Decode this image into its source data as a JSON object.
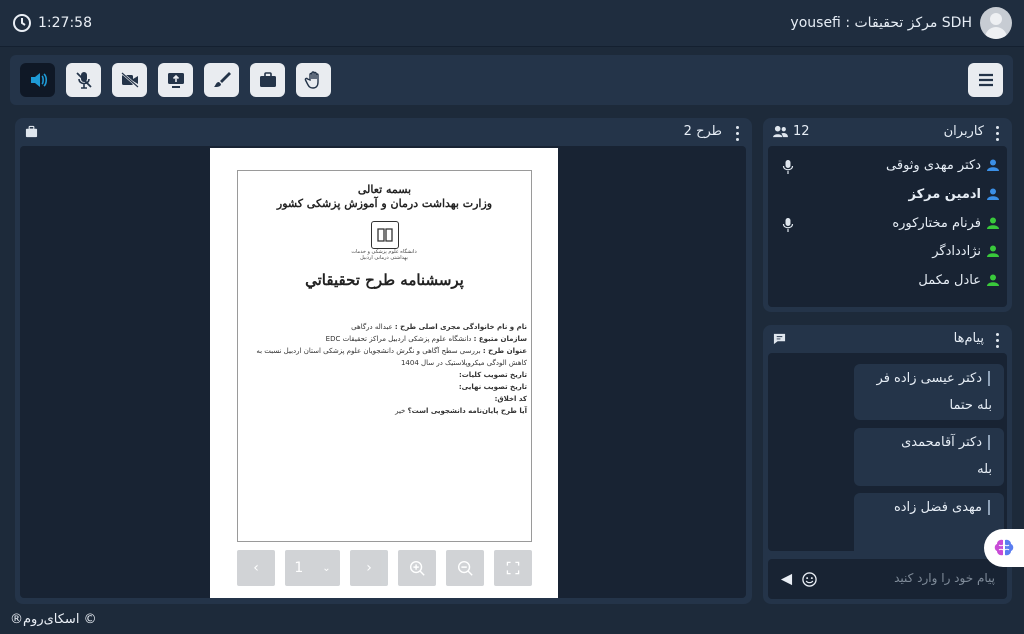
{
  "header": {
    "clock": "1:27:58",
    "user_label": "yousefi : مرکز تحقیقات SDH"
  },
  "toolbar": {
    "buttons": [
      "speaker",
      "microphone-muted",
      "camera-off",
      "share-screen",
      "brush",
      "briefcase",
      "raise-hand"
    ],
    "active_color": "#0f1826",
    "accent": "#1e9ad6"
  },
  "presentation": {
    "title": "طرح 2",
    "doc": {
      "line1": "بسمه تعالی",
      "line2": "وزارت بهداشت درمان و آموزش پزشکی کشور",
      "logo_text": "دانشگاه علوم پزشکی و خدمات بهداشتی درمانی اردبیل",
      "main_title": "پرسشنامه طرح تحقیقاتي",
      "fields": [
        {
          "label": "نام و نام خانوادگی مجری اصلی طرح :",
          "value": "عبداله درگاهی"
        },
        {
          "label": "سازمان متبوع :",
          "value": "دانشگاه علوم پزشکی اردبیل مراکز تحقیقات EDC"
        },
        {
          "label": "عنوان طرح :",
          "value": "بررسی سطح آگاهی و نگرش دانشجویان علوم پزشکی استان اردبیل نسبت به کاهش الودگی میکروپلاستیک در سال 1404"
        },
        {
          "label": "تاریخ تصویب کلیات:",
          "value": ""
        },
        {
          "label": "تاریخ تصویب نهایی:",
          "value": ""
        },
        {
          "label": "کد اخلاق:",
          "value": ""
        },
        {
          "label": "آیا طرح پایان‌نامه دانشجویی است؟",
          "value": "خیر"
        }
      ]
    },
    "pager": {
      "page": "1"
    }
  },
  "users": {
    "title": "کاربران",
    "count": "12",
    "items": [
      {
        "name": "دکتر مهدی وثوقی",
        "color": "#3b8fe6",
        "mic": true,
        "bold": false
      },
      {
        "name": "ادمین مرکز",
        "color": "#3b8fe6",
        "mic": false,
        "bold": true
      },
      {
        "name": "فرنام مختارکوره",
        "color": "#39c93b",
        "mic": true,
        "bold": false
      },
      {
        "name": "نژاددادگر",
        "color": "#39c93b",
        "mic": false,
        "bold": false
      },
      {
        "name": "عادل مکمل",
        "color": "#39c93b",
        "mic": false,
        "bold": false
      }
    ]
  },
  "chat": {
    "title": "پیام‌ها",
    "messages": [
      {
        "sender": "دکتر عیسی زاده فر",
        "text": "بله حتما"
      },
      {
        "sender": "دکتر آقامحمدی",
        "text": "بله"
      },
      {
        "sender": "مهدی فضل زاده",
        "text": ""
      }
    ],
    "input_placeholder": "پیام خود را وارد کنید"
  },
  "footer": {
    "brand": "اسکای‌روم®"
  }
}
